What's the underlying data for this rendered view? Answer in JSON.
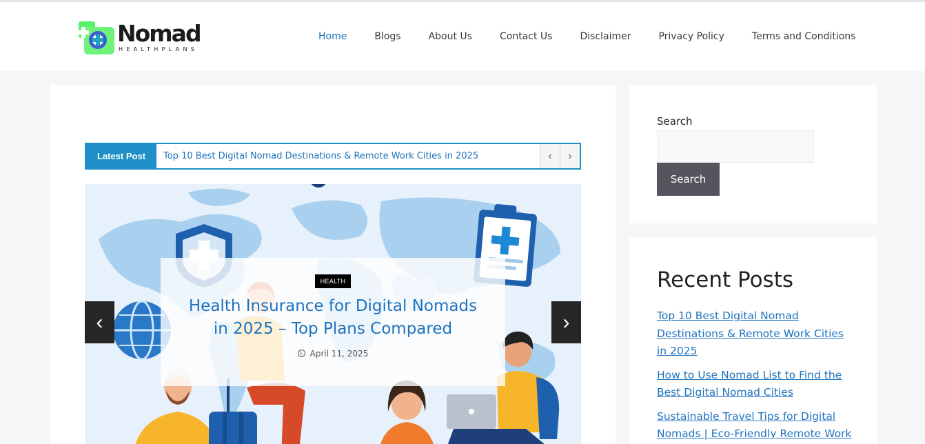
{
  "brand": {
    "name": "Nomad",
    "tagline": "HEALTHPLANS",
    "accent": "#1e73be",
    "logo_green": "#5cf06a"
  },
  "nav": {
    "items": [
      {
        "label": "Home",
        "active": true
      },
      {
        "label": "Blogs"
      },
      {
        "label": "About Us"
      },
      {
        "label": "Contact Us"
      },
      {
        "label": "Disclaimer"
      },
      {
        "label": "Privacy Policy"
      },
      {
        "label": "Terms and Conditions"
      }
    ]
  },
  "ticker": {
    "label": "Latest Post",
    "text": "Top 10 Best Digital Nomad Destinations & Remote Work Cities in 2025",
    "prev_icon": "chevron-left-icon",
    "next_icon": "chevron-right-icon"
  },
  "slider": {
    "category": "HEALTH",
    "title": "Health Insurance for Digital Nomads in 2025 – Top Plans Compared",
    "date": "April 11, 2025",
    "prev_glyph": "‹",
    "next_glyph": "›"
  },
  "sidebar": {
    "search_label": "Search",
    "search_value": "",
    "search_button": "Search",
    "recent_title": "Recent Posts",
    "recent_posts": [
      "Top 10 Best Digital Nomad Destinations & Remote Work Cities in 2025",
      "How to Use Nomad List to Find the Best Digital Nomad Cities",
      "Sustainable Travel Tips for Digital Nomads | Eco-Friendly Remote Work"
    ]
  }
}
